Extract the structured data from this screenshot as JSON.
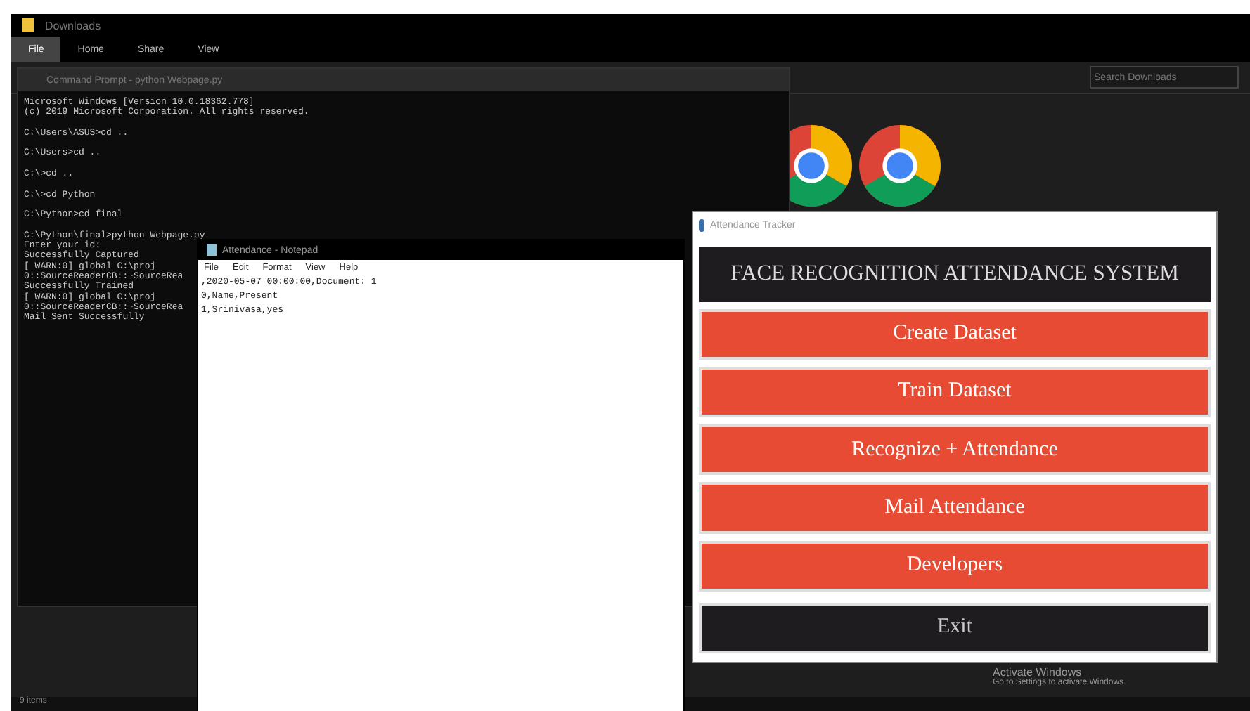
{
  "explorer": {
    "title": "Downloads",
    "ribbon_tabs": [
      {
        "label": "File",
        "selected": true
      },
      {
        "label": "Home",
        "selected": false
      },
      {
        "label": "Share",
        "selected": false
      },
      {
        "label": "View",
        "selected": false
      }
    ],
    "search": {
      "placeholder": "Search Downloads"
    },
    "status_bar": "9 items"
  },
  "cmd": {
    "title": "Command Prompt - python Webpage.py",
    "blocks": [
      [
        "Microsoft Windows [Version 10.0.18362.778]",
        "(c) 2019 Microsoft Corporation. All rights reserved."
      ],
      [
        "C:\\Users\\ASUS>cd .."
      ],
      [
        "C:\\Users>cd .."
      ],
      [
        "C:\\>cd .."
      ],
      [
        "C:\\>cd Python"
      ],
      [
        "C:\\Python>cd final"
      ],
      [
        "C:\\Python\\final>python Webpage.py",
        "Enter your id:",
        "Successfully Captured",
        "[ WARN:0] global C:\\proj",
        "0::SourceReaderCB::~SourceRea",
        "Successfully Trained",
        "[ WARN:0] global C:\\proj",
        "0::SourceReaderCB::~SourceRea",
        "Mail Sent Successfully"
      ]
    ]
  },
  "notepad": {
    "title": "Attendance - Notepad",
    "menu": [
      "File",
      "Edit",
      "Format",
      "View",
      "Help"
    ],
    "lines": [
      ",2020-05-07 00:00:00,Document: 1",
      "0,Name,Present",
      "1,Srinivasa,yes"
    ]
  },
  "app": {
    "title": "Attendance Tracker",
    "heading": "FACE RECOGNITION ATTENDANCE SYSTEM",
    "buttons": [
      {
        "label": "Create Dataset",
        "kind": "action"
      },
      {
        "label": "Train Dataset",
        "kind": "action"
      },
      {
        "label": "Recognize + Attendance",
        "kind": "action"
      },
      {
        "label": "Mail Attendance",
        "kind": "action"
      },
      {
        "label": "Developers",
        "kind": "action"
      },
      {
        "label": "Exit",
        "kind": "exit"
      }
    ]
  },
  "activation": {
    "title": "Activate Windows",
    "subtitle": "Go to Settings to activate Windows."
  }
}
